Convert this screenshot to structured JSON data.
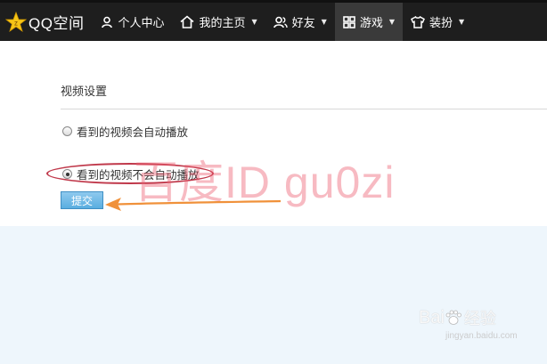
{
  "topbar": {
    "logo_text": "QQ空间",
    "items": [
      {
        "label": "个人中心",
        "icon": "person-icon"
      },
      {
        "label": "我的主页",
        "icon": "home-icon",
        "caret": "▼"
      },
      {
        "label": "好友",
        "icon": "friends-icon",
        "caret": "▼"
      },
      {
        "label": "游戏",
        "icon": "grid-icon",
        "caret": "▼",
        "active": true
      },
      {
        "label": "装扮",
        "icon": "shirt-icon",
        "caret": "▼"
      }
    ]
  },
  "settings": {
    "title": "视频设置",
    "options": [
      {
        "label": "看到的视频会自动播放",
        "checked": false
      },
      {
        "label": "看到的视频不会自动播放",
        "checked": true
      }
    ],
    "submit_label": "提交"
  },
  "annotation": {
    "watermark": "百度ID gu0zi",
    "highlight_color": "#c0394b",
    "arrow_color": "#f0913a"
  },
  "baidu": {
    "logo": "Bai",
    "logo_suffix": "经验",
    "url": "jingyan.baidu.com"
  }
}
